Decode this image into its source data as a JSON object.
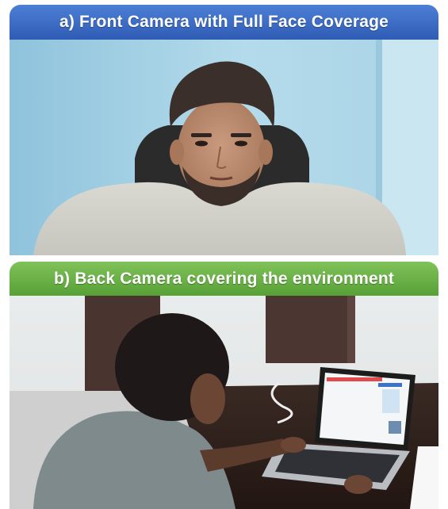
{
  "panels": [
    {
      "label": "a) Front Camera with Full Face Coverage",
      "banner_color": "#3a68c4",
      "photo": "front-camera-photo"
    },
    {
      "label": "b) Back Camera covering the environment",
      "banner_color": "#66ad40",
      "photo": "back-camera-photo"
    }
  ]
}
